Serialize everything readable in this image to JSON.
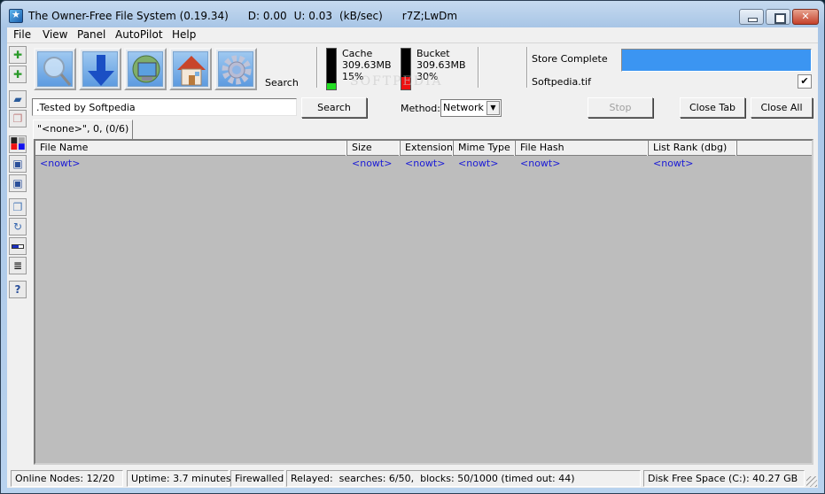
{
  "window": {
    "title": "The Owner-Free File System (0.19.34)",
    "download_rate": "D: 0.00",
    "upload_rate": "U: 0.03",
    "rate_unit": "(kB/sec)",
    "node_id": "r7Z;LwDm"
  },
  "menu": [
    "File",
    "View",
    "Panel",
    "AutoPilot",
    "Help"
  ],
  "toolbar": {
    "buttons": [
      {
        "name": "search",
        "icon": "magnifier-icon"
      },
      {
        "name": "download",
        "icon": "download-arrow-icon"
      },
      {
        "name": "network",
        "icon": "globe-monitor-icon"
      },
      {
        "name": "home",
        "icon": "home-icon"
      },
      {
        "name": "settings",
        "icon": "gear-icon"
      }
    ],
    "current_label": "Search",
    "cache": {
      "label": "Cache",
      "size": "309.63MB",
      "percent_text": "15%",
      "fill_fraction": 0.15,
      "color": "#22dd22"
    },
    "bucket": {
      "label": "Bucket",
      "size": "309.63MB",
      "percent_text": "30%",
      "fill_fraction": 0.3,
      "color": "#ee1111"
    },
    "store": {
      "status": "Store Complete",
      "file": "Softpedia.tif",
      "progress_fraction": 1.0,
      "bar_color": "#3b95f2",
      "checked": "✔"
    }
  },
  "sidebar": [
    {
      "name": "new-item-1",
      "icon": "add-document-icon"
    },
    {
      "name": "new-item-2",
      "icon": "add-document-icon"
    },
    {
      "name": "open-folder",
      "icon": "open-folder-icon"
    },
    {
      "name": "copy",
      "icon": "copy-icon"
    },
    {
      "name": "palette",
      "icon": "color-palette-icon"
    },
    {
      "name": "save",
      "icon": "save-icon"
    },
    {
      "name": "save-as",
      "icon": "save-icon"
    },
    {
      "name": "paste",
      "icon": "paste-icon"
    },
    {
      "name": "refresh",
      "icon": "refresh-icon"
    },
    {
      "name": "progress",
      "icon": "progress-bar-icon"
    },
    {
      "name": "list",
      "icon": "text-lines-icon"
    },
    {
      "name": "help",
      "icon": "help-icon"
    }
  ],
  "search": {
    "query": ".Tested by Softpedia",
    "search_button": "Search",
    "method_label": "Method:",
    "method_value": "Network",
    "stop_button": "Stop",
    "close_tab_button": "Close Tab",
    "close_all_button": "Close All"
  },
  "tab": {
    "label": "\"<none>\", 0, (0/6)"
  },
  "grid": {
    "columns": [
      "File Name",
      "Size",
      "Extension",
      "Mime Type",
      "File Hash",
      "List Rank (dbg)"
    ],
    "rows": [
      [
        "<nowt>",
        "<nowt>",
        "<nowt>",
        "<nowt>",
        "<nowt>",
        "<nowt>"
      ]
    ]
  },
  "status": {
    "online_nodes": "Online Nodes: 12/20",
    "uptime": "Uptime: 3.7 minutes",
    "firewall": "Firewalled",
    "relayed": "Relayed:  searches: 6/50,  blocks: 50/1000 (timed out: 44)",
    "disk": "Disk Free Space (C:): 40.27 GB"
  },
  "watermark": "SOFTPEDIA"
}
